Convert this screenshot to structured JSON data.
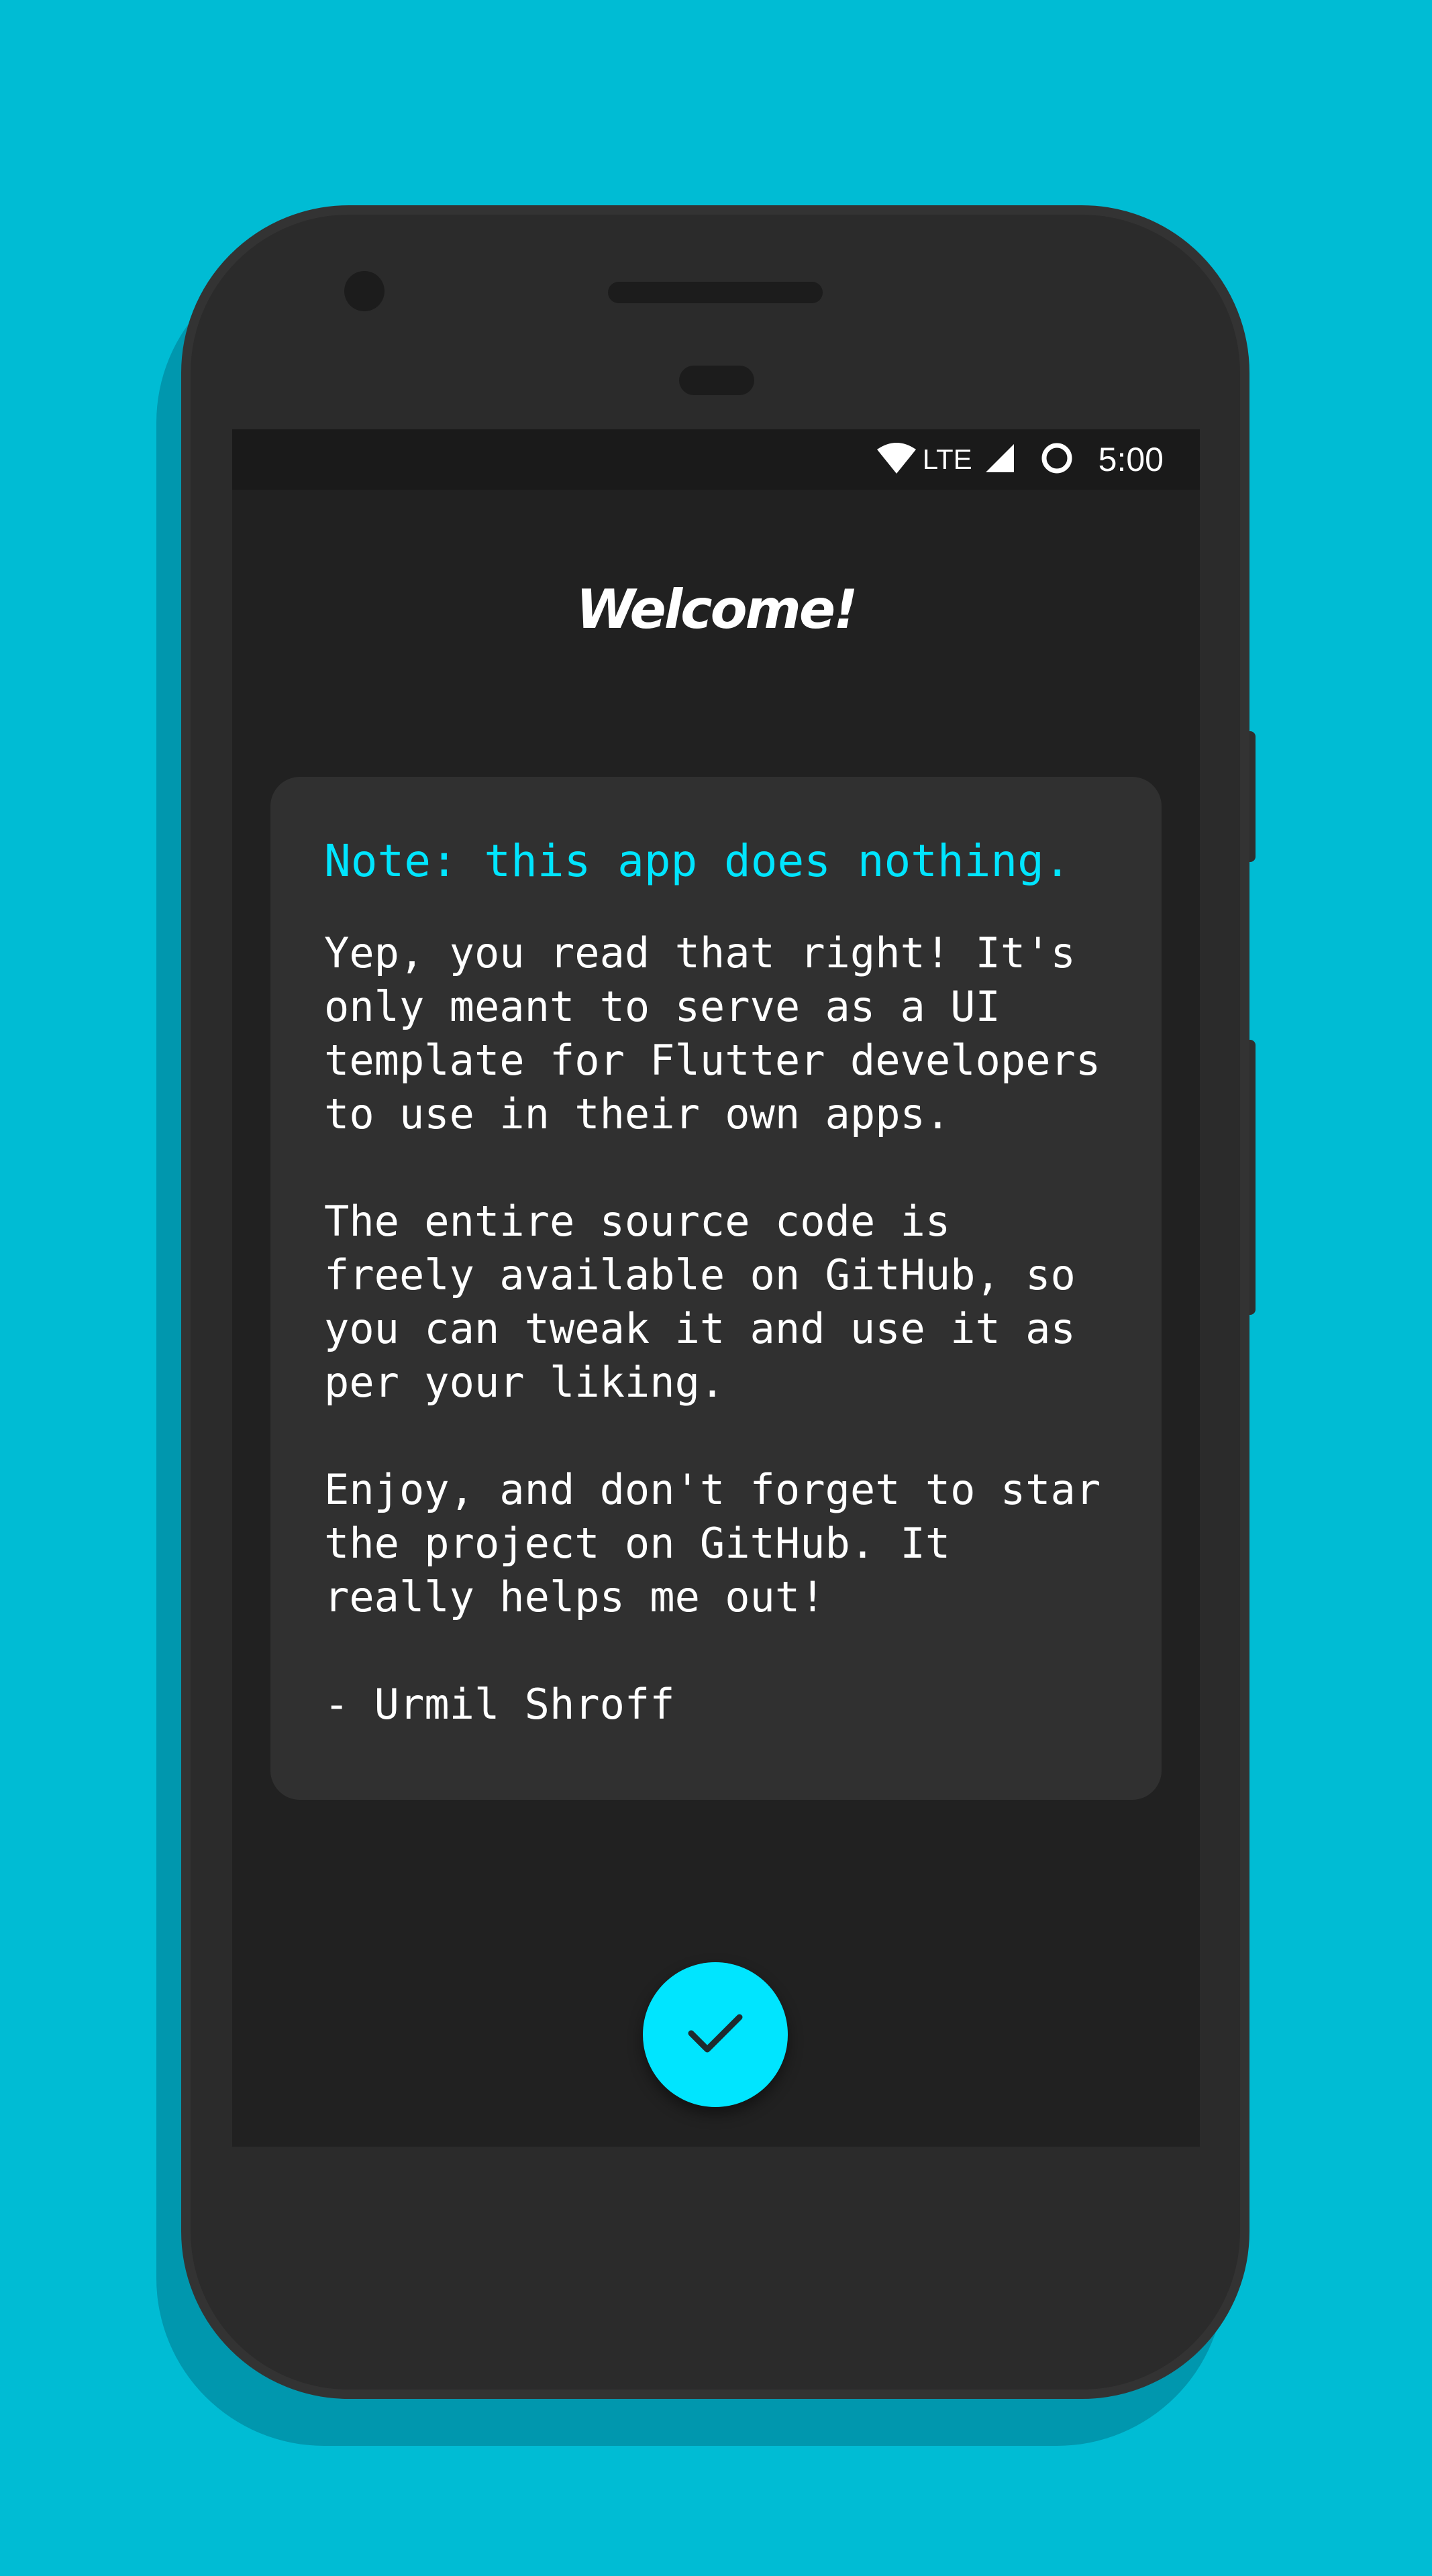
{
  "status_bar": {
    "network_label": "LTE",
    "time": "5:00",
    "icons": [
      "wifi-icon",
      "cellular-signal-icon",
      "notification-ring-icon"
    ]
  },
  "welcome": {
    "title": "Welcome!",
    "note": "Note: this app does nothing.",
    "paragraphs": [
      "Yep, you read that right! It's\nonly meant to serve as a UI\ntemplate for Flutter developers\nto use in their own apps.",
      "The entire source code is\nfreely available on GitHub, so\nyou can tweak it and use it as\nper your liking.",
      "Enjoy, and don't forget to star\nthe project on GitHub. It\nreally helps me out!"
    ],
    "signature": "- Urmil Shroff"
  },
  "fab": {
    "icon": "check-icon"
  },
  "colors": {
    "background": "#00BCD4",
    "accent": "#00E5FF",
    "screen": "#212121",
    "card": "#303030",
    "text": "#FFFFFF"
  }
}
